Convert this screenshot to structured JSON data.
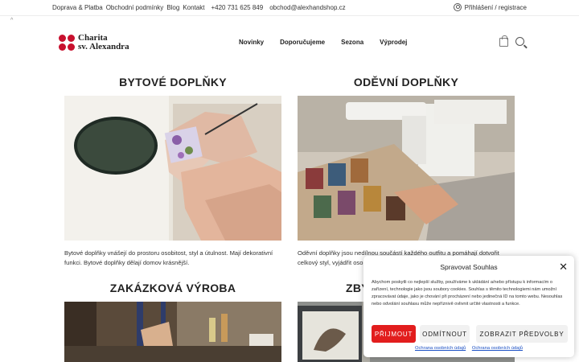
{
  "topbar": {
    "links": [
      "Doprava & Platba",
      "Obchodní podmínky",
      "Blog",
      "Kontakt"
    ],
    "phone": "+420 731 625 849",
    "email": "obchod@alexhandshop.cz",
    "account": "Přihlášení / registrace"
  },
  "logo": {
    "line1": "Charita",
    "line2": "sv. Alexandra",
    "color": "#c8102e"
  },
  "nav": [
    "Novinky",
    "Doporučujeme",
    "Sezona",
    "Výprodej"
  ],
  "categories": [
    {
      "title": "BYTOVÉ DOPLŇKY",
      "description": "Bytové doplňky vnášejí do prostoru osobitost, styl a útulnost. Mají dekorativní funkci. Bytové doplňky dělají domov krásnější."
    },
    {
      "title": "ODĚVNÍ DOPLŇKY",
      "description": "Oděvní doplňky jsou nedílnou součástí každého outfitu a pomáhají dotvořit celkový styl, vyjádřit osobitost či..."
    },
    {
      "title": "ZAKÁZKOVÁ VÝROBA"
    },
    {
      "title": "ZBY"
    }
  ],
  "cookie": {
    "title": "Spravovat Souhlas",
    "text": "Abychom poskytli co nejlepší služby, používáme k ukládání a/nebo přístupu k informacím o zařízení, technologie jako jsou soubory cookies. Souhlas s těmito technologiemi nám umožní zpracovávat údaje, jako je chování při procházení nebo jedinečná ID na tomto webu. Nesouhlas nebo odvolání souhlasu může nepříznivě ovlivnit určité vlastnosti a funkce.",
    "accept": "PŘIJMOUT",
    "deny": "ODMÍTNOUT",
    "preferences": "ZOBRAZIT PŘEDVOLBY",
    "link1": "Ochrana osobních údajů",
    "link2": "Ochrana osobních údajů",
    "accent": "#e21d1d"
  }
}
